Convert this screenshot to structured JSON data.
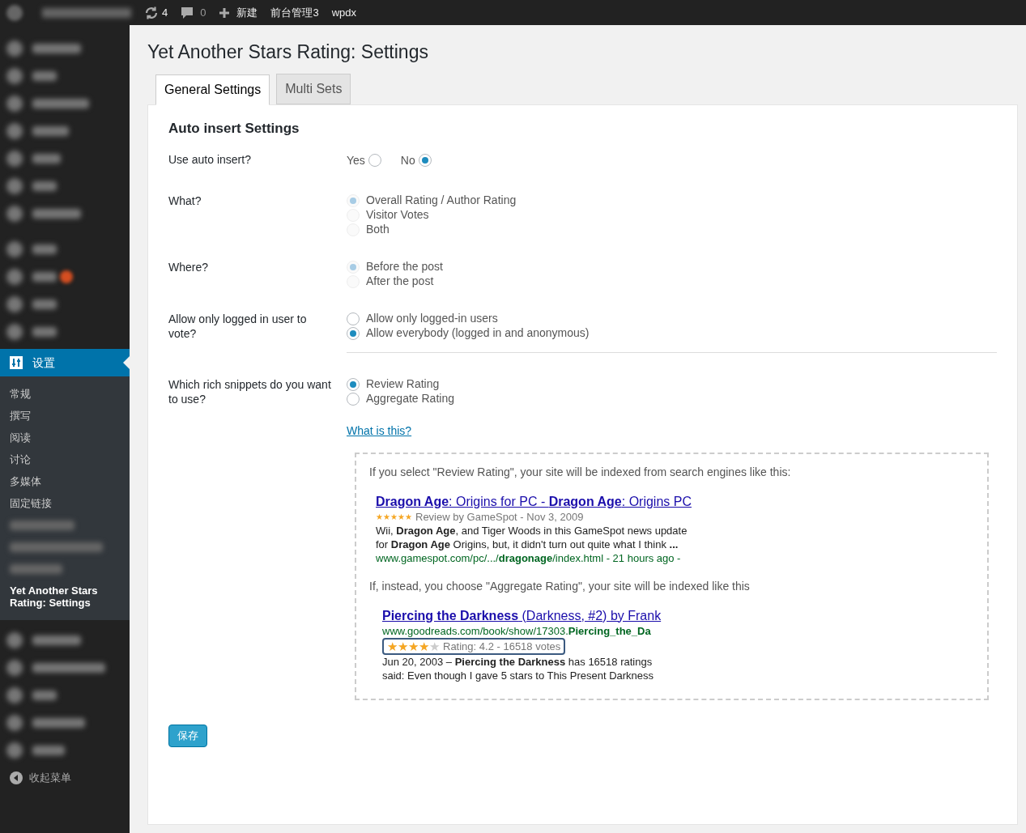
{
  "admin_bar": {
    "updates": "4",
    "comments": "0",
    "new": "新建",
    "items": [
      "前台管理3",
      "wpdx"
    ]
  },
  "sidebar": {
    "active": {
      "label": "设置"
    },
    "submenu": [
      {
        "label": "常规",
        "selected": false
      },
      {
        "label": "撰写",
        "selected": false
      },
      {
        "label": "阅读",
        "selected": false
      },
      {
        "label": "讨论",
        "selected": false
      },
      {
        "label": "多媒体",
        "selected": false
      },
      {
        "label": "固定链接",
        "selected": false
      },
      {
        "label": "Yet Another Stars Rating: Settings",
        "selected": true
      }
    ],
    "collapse": "收起菜单"
  },
  "page": {
    "title": "Yet Another Stars Rating: Settings",
    "tabs": [
      {
        "label": "General Settings",
        "selected": true
      },
      {
        "label": "Multi Sets",
        "selected": false
      }
    ],
    "section_title": "Auto insert Settings",
    "sections": [
      {
        "fields": [
          {
            "kind": "inline",
            "label": "Use auto insert?",
            "disabled": false,
            "options": [
              {
                "label": "Yes",
                "selected": false
              },
              {
                "label": "No",
                "selected": true
              }
            ]
          },
          {
            "kind": "list",
            "label": "What?",
            "disabled": true,
            "options": [
              {
                "label": "Overall Rating / Author Rating",
                "selected": true
              },
              {
                "label": "Visitor Votes",
                "selected": false
              },
              {
                "label": "Both",
                "selected": false
              }
            ]
          },
          {
            "kind": "list",
            "label": "Where?",
            "disabled": true,
            "options": [
              {
                "label": "Before the post",
                "selected": true
              },
              {
                "label": "After the post",
                "selected": false
              }
            ]
          },
          {
            "kind": "list",
            "label": "Allow only logged in user to vote?",
            "disabled": false,
            "options": [
              {
                "label": "Allow only logged-in users",
                "selected": false
              },
              {
                "label": "Allow everybody (logged in and anonymous)",
                "selected": true
              }
            ]
          }
        ]
      },
      {
        "fields": [
          {
            "kind": "list",
            "label": "Which rich snippets do you want to use?",
            "disabled": false,
            "options": [
              {
                "label": "Review Rating",
                "selected": true
              },
              {
                "label": "Aggregate Rating",
                "selected": false
              }
            ],
            "link": "What is this?",
            "examples": [
              {
                "intro": "If you select \"Review Rating\", your site will be indexed from search engines like this:",
                "highlighted": false,
                "title": "**Dragon Age**: Origins for PC - **Dragon Age**: Origins PC",
                "url_first": false,
                "stars": 5,
                "meta": "Review by GameSpot - Nov 3, 2009",
                "url": "www.gamespot.com/pc/.../**dragonage**/index.html - 21 hours ago -",
                "lines": [
                  "Wii, **Dragon Age**, and Tiger Woods in this GameSpot news update",
                  "for **Dragon Age** Origins, but, it didn't turn out quite what I think **...**"
                ]
              },
              {
                "intro": "If, instead, you choose \"Aggregate Rating\", your site will be indexed like this",
                "highlighted": true,
                "title": "**Piercing the Darkness** (Darkness, #2) by Frank",
                "url_first": true,
                "stars": 4,
                "meta": "Rating: 4.2 - 16518 votes",
                "url": "www.goodreads.com/book/show/17303.**Piercing_the_Da**",
                "lines": [
                  "Jun 20, 2003 – **Piercing the Darkness** has 16518 ratings",
                  "said: Even though I gave 5 stars to This Present Darkness"
                ]
              }
            ]
          }
        ]
      }
    ],
    "save": "保存"
  }
}
